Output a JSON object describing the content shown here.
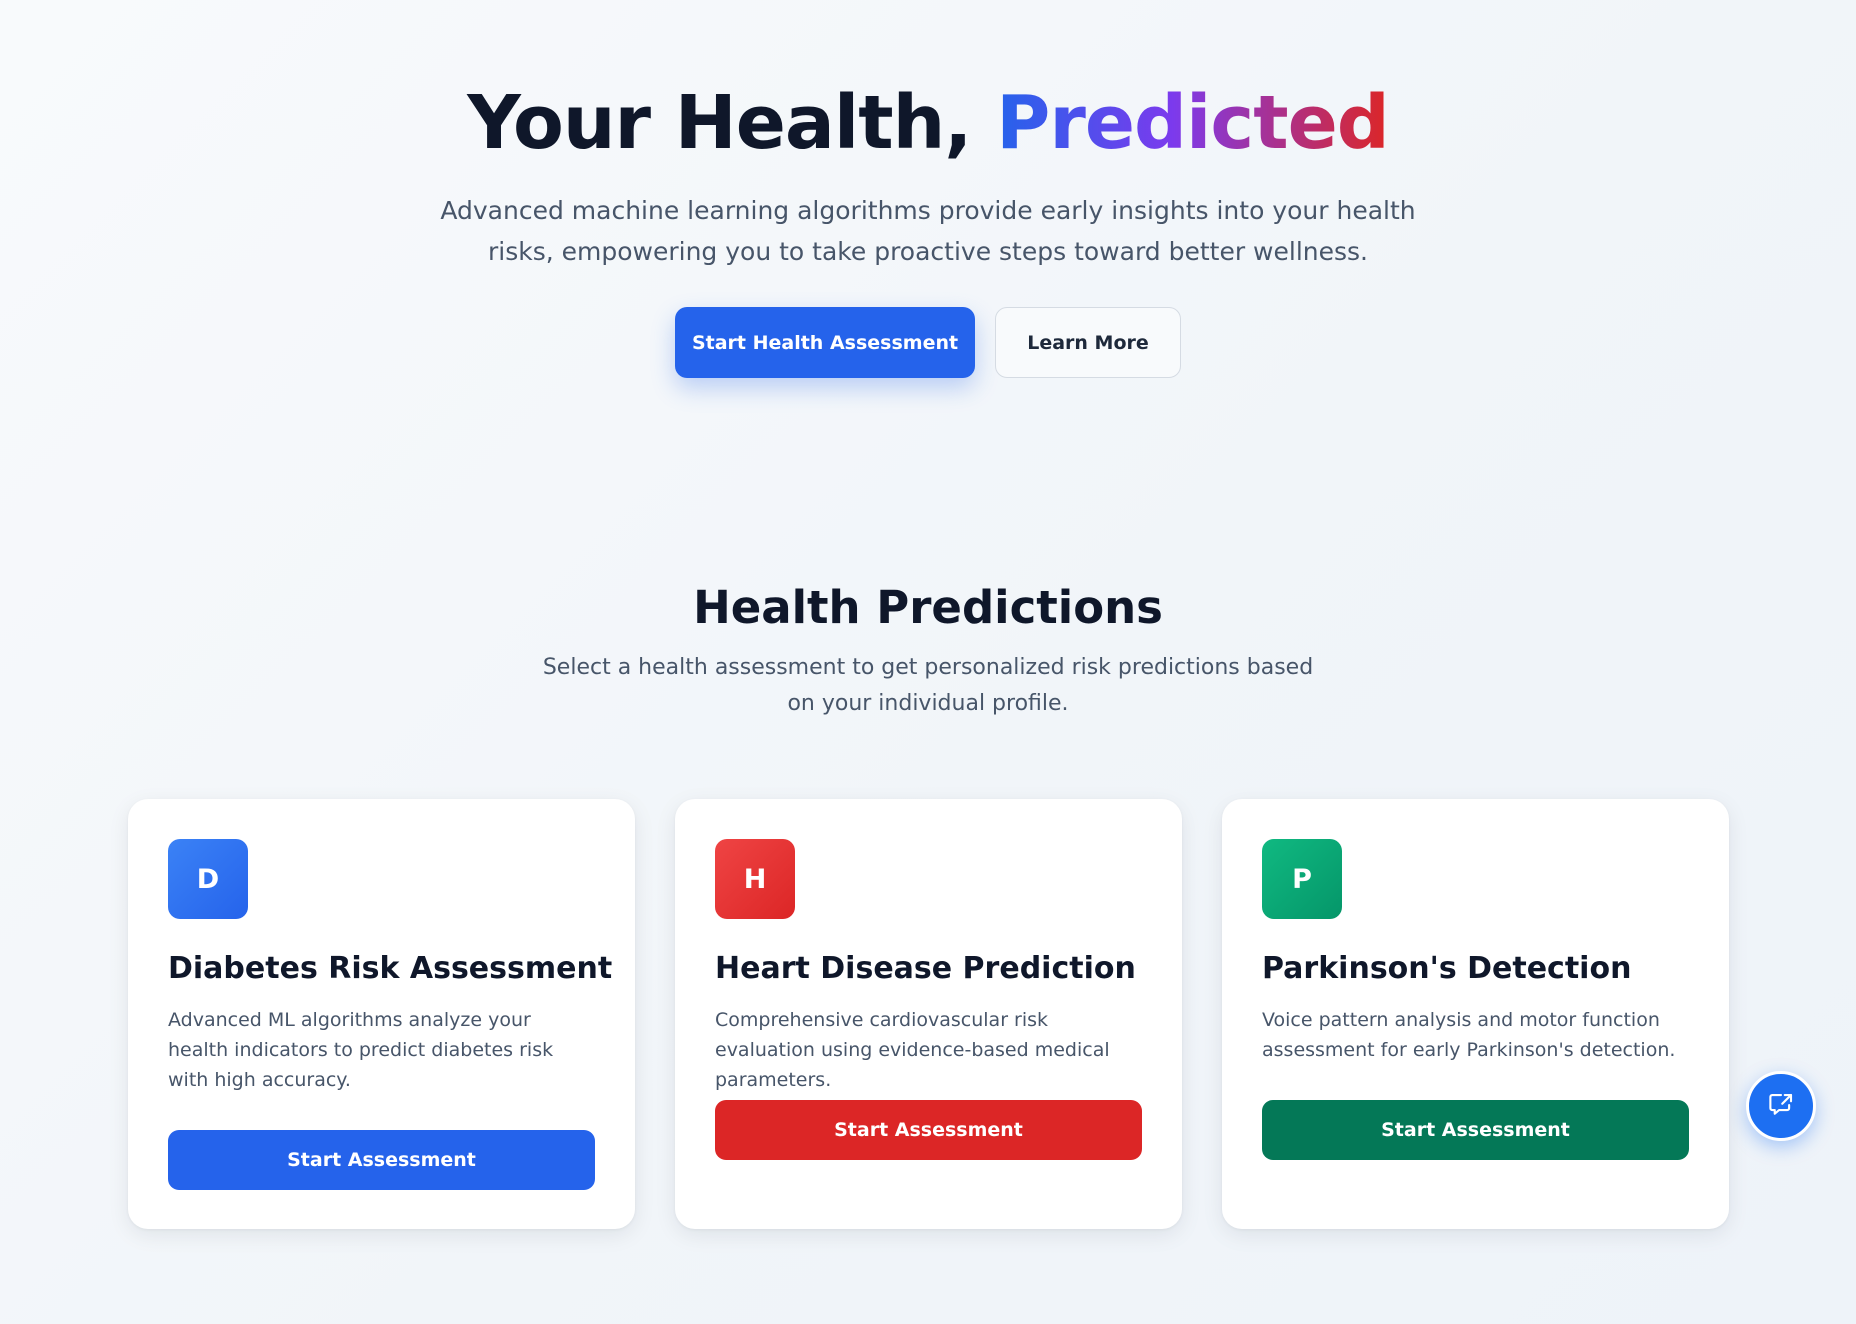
{
  "hero": {
    "title_main": "Your Health, ",
    "title_accent": "Predicted",
    "subtitle": "Advanced machine learning algorithms provide early insights into your health risks, empowering you to take proactive steps toward better wellness.",
    "primary_button": "Start Health Assessment",
    "secondary_button": "Learn More"
  },
  "section": {
    "title": "Health Predictions",
    "subtitle": "Select a health assessment to get personalized risk predictions based on your individual profile."
  },
  "cards": [
    {
      "icon_letter": "D",
      "title": "Diabetes Risk Assessment",
      "description": "Advanced ML algorithms analyze your health indicators to predict diabetes risk with high accuracy.",
      "button": "Start Assessment",
      "color": "#2563eb"
    },
    {
      "icon_letter": "H",
      "title": "Heart Disease Prediction",
      "description": "Comprehensive cardiovascular risk evaluation using evidence-based medical parameters.",
      "button": "Start Assessment",
      "color": "#dc2626"
    },
    {
      "icon_letter": "P",
      "title": "Parkinson's Detection",
      "description": "Voice pattern analysis and motor function assessment for early Parkinson's detection.",
      "button": "Start Assessment",
      "color": "#047857"
    }
  ],
  "fab": {
    "icon": "chat-share-icon",
    "color": "#1d6ff2"
  },
  "colors": {
    "primary": "#2563eb",
    "heart": "#dc2626",
    "parkinson": "#047857",
    "text_dark": "#0f172a",
    "text_muted": "#475569"
  }
}
